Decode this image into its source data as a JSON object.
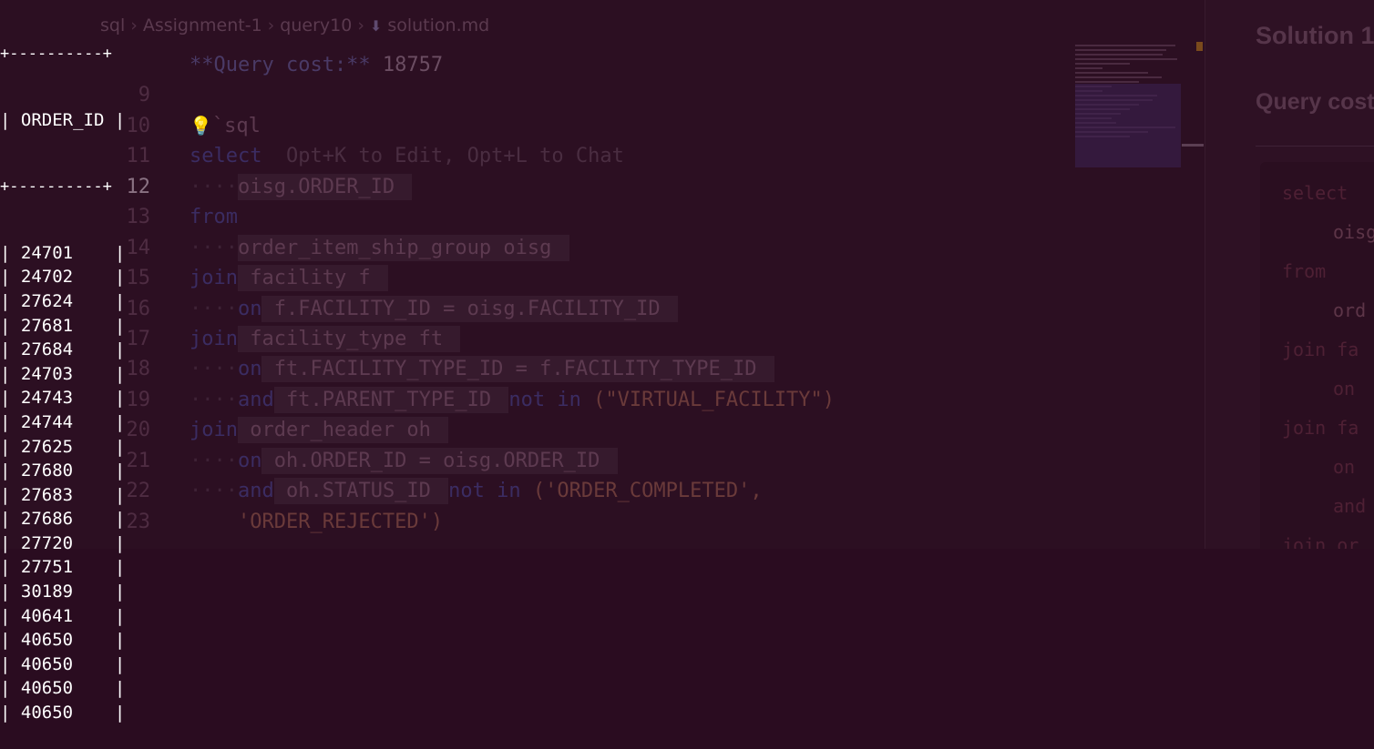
{
  "editor": {
    "breadcrumb": [
      "sql",
      "Assignment-1",
      "query10",
      "solution.md"
    ],
    "line_numbers": [
      "9",
      "10",
      "11",
      "12",
      "13",
      "14",
      "15",
      "16",
      "17",
      "18",
      "19",
      "20",
      "21",
      "22",
      "23"
    ],
    "active_line": "12",
    "lines": [
      {
        "parts": [
          {
            "t": "**Query cost:** ",
            "c": "md-head"
          },
          {
            "t": "18757",
            "c": "md-num"
          }
        ]
      },
      {
        "parts": []
      },
      {
        "parts": [
          {
            "t": "`sql",
            "c": ""
          }
        ],
        "bulb": true
      },
      {
        "parts": [
          {
            "t": "select",
            "c": "kw"
          },
          {
            "t": "  Opt+K to Edit, Opt+L to Chat",
            "c": "ghost"
          }
        ]
      },
      {
        "parts": [
          {
            "t": "····",
            "c": "dots"
          },
          {
            "t": "oisg.ORDER_ID ",
            "c": "hl"
          }
        ]
      },
      {
        "parts": [
          {
            "t": "from",
            "c": "kw"
          }
        ]
      },
      {
        "parts": [
          {
            "t": "····",
            "c": "dots"
          },
          {
            "t": "order_item_ship_group oisg ",
            "c": "hl"
          }
        ]
      },
      {
        "parts": [
          {
            "t": "join",
            "c": "kw"
          },
          {
            "t": " facility f ",
            "c": "hl"
          }
        ]
      },
      {
        "parts": [
          {
            "t": "····",
            "c": "dots"
          },
          {
            "t": "on",
            "c": "kw"
          },
          {
            "t": " f.FACILITY_ID = oisg.FACILITY_ID ",
            "c": "hl"
          }
        ]
      },
      {
        "parts": [
          {
            "t": "join",
            "c": "kw"
          },
          {
            "t": " facility_type ft ",
            "c": "hl"
          }
        ]
      },
      {
        "parts": [
          {
            "t": "····",
            "c": "dots"
          },
          {
            "t": "on",
            "c": "kw"
          },
          {
            "t": " ft.FACILITY_TYPE_ID = f.FACILITY_TYPE_ID ",
            "c": "hl"
          }
        ]
      },
      {
        "parts": [
          {
            "t": "····",
            "c": "dots"
          },
          {
            "t": "and",
            "c": "kw"
          },
          {
            "t": " ft.PARENT_TYPE_ID ",
            "c": "hl"
          },
          {
            "t": "not in",
            "c": "kw"
          },
          {
            "t": " (\"VIRTUAL_FACILITY\") ",
            "c": "str"
          }
        ]
      },
      {
        "parts": [
          {
            "t": "join",
            "c": "kw"
          },
          {
            "t": " order_header oh ",
            "c": "hl"
          }
        ]
      },
      {
        "parts": [
          {
            "t": "····",
            "c": "dots"
          },
          {
            "t": "on",
            "c": "kw"
          },
          {
            "t": " oh.ORDER_ID = oisg.ORDER_ID ",
            "c": "hl"
          }
        ]
      },
      {
        "parts": [
          {
            "t": "····",
            "c": "dots"
          },
          {
            "t": "and",
            "c": "kw"
          },
          {
            "t": " oh.STATUS_ID ",
            "c": "hl"
          },
          {
            "t": "not in",
            "c": "kw"
          },
          {
            "t": " ('ORDER_COMPLETED', ",
            "c": "str"
          }
        ]
      },
      {
        "parts": [
          {
            "t": "    ",
            "c": ""
          },
          {
            "t": "'ORDER_REJECTED') ",
            "c": "str"
          }
        ]
      }
    ]
  },
  "preview": {
    "title": "Solution 1",
    "cost": "Query cost",
    "code": [
      {
        "t": "select",
        "kw": true,
        "indent": 0
      },
      {
        "t": "oisg",
        "kw": false,
        "indent": 1
      },
      {
        "t": "from",
        "kw": true,
        "indent": 0
      },
      {
        "t": "ord",
        "kw": false,
        "indent": 1
      },
      {
        "t": "join fa",
        "kw": true,
        "indent": 0
      },
      {
        "t": "on",
        "kw": true,
        "indent": 1
      },
      {
        "t": "join fa",
        "kw": true,
        "indent": 0
      },
      {
        "t": "on",
        "kw": true,
        "indent": 1
      },
      {
        "t": "and",
        "kw": true,
        "indent": 1
      },
      {
        "t": "join or",
        "kw": true,
        "indent": 0
      }
    ]
  },
  "result": {
    "border": "+----------+",
    "header": "| ORDER_ID |",
    "rows": [
      "24701",
      "24702",
      "27624",
      "27681",
      "27684",
      "24703",
      "24743",
      "24744",
      "27625",
      "27680",
      "27683",
      "27686",
      "27720",
      "27751",
      "30189",
      "40641",
      "40650",
      "40650",
      "40650",
      "40650"
    ]
  },
  "colors": {
    "background": "#2c0f22",
    "terminal_text": "#ffffff"
  }
}
